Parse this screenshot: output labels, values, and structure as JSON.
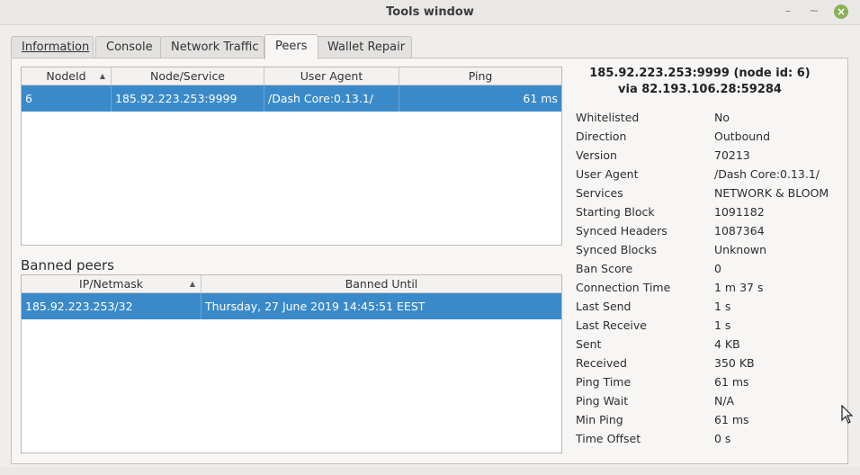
{
  "window": {
    "title": "Tools window"
  },
  "tabs": [
    {
      "label": "Information",
      "active": false
    },
    {
      "label": "Console",
      "active": false
    },
    {
      "label": "Network Traffic",
      "active": false
    },
    {
      "label": "Peers",
      "active": true
    },
    {
      "label": "Wallet Repair",
      "active": false
    }
  ],
  "peers_table": {
    "columns": [
      "NodeId",
      "Node/Service",
      "User Agent",
      "Ping"
    ],
    "rows": [
      {
        "node_id": "6",
        "service": "185.92.223.253:9999",
        "user_agent": "/Dash Core:0.13.1/",
        "ping": "61 ms"
      }
    ]
  },
  "banned": {
    "label": "Banned peers",
    "columns": [
      "IP/Netmask",
      "Banned Until"
    ],
    "rows": [
      {
        "ip": "185.92.223.253/32",
        "until": "Thursday, 27 June 2019 14:45:51 EEST"
      }
    ]
  },
  "details": {
    "header_line1": "185.92.223.253:9999 (node id: 6)",
    "header_line2": "via 82.193.106.28:59284",
    "properties": [
      {
        "label": "Whitelisted",
        "value": "No"
      },
      {
        "label": "Direction",
        "value": "Outbound"
      },
      {
        "label": "Version",
        "value": "70213"
      },
      {
        "label": "User Agent",
        "value": "/Dash Core:0.13.1/"
      },
      {
        "label": "Services",
        "value": "NETWORK & BLOOM"
      },
      {
        "label": "Starting Block",
        "value": "1091182"
      },
      {
        "label": "Synced Headers",
        "value": "1087364"
      },
      {
        "label": "Synced Blocks",
        "value": "Unknown"
      },
      {
        "label": "Ban Score",
        "value": "0"
      },
      {
        "label": "Connection Time",
        "value": "1 m 37 s"
      },
      {
        "label": "Last Send",
        "value": "1 s"
      },
      {
        "label": "Last Receive",
        "value": "1 s"
      },
      {
        "label": "Sent",
        "value": "4 KB"
      },
      {
        "label": "Received",
        "value": "350 KB"
      },
      {
        "label": "Ping Time",
        "value": "61 ms"
      },
      {
        "label": "Ping Wait",
        "value": "N/A"
      },
      {
        "label": "Min Ping",
        "value": "61 ms"
      },
      {
        "label": "Time Offset",
        "value": "0 s"
      }
    ]
  },
  "colors": {
    "selection": "#3a8ac9",
    "close_button": "#8bb158"
  }
}
